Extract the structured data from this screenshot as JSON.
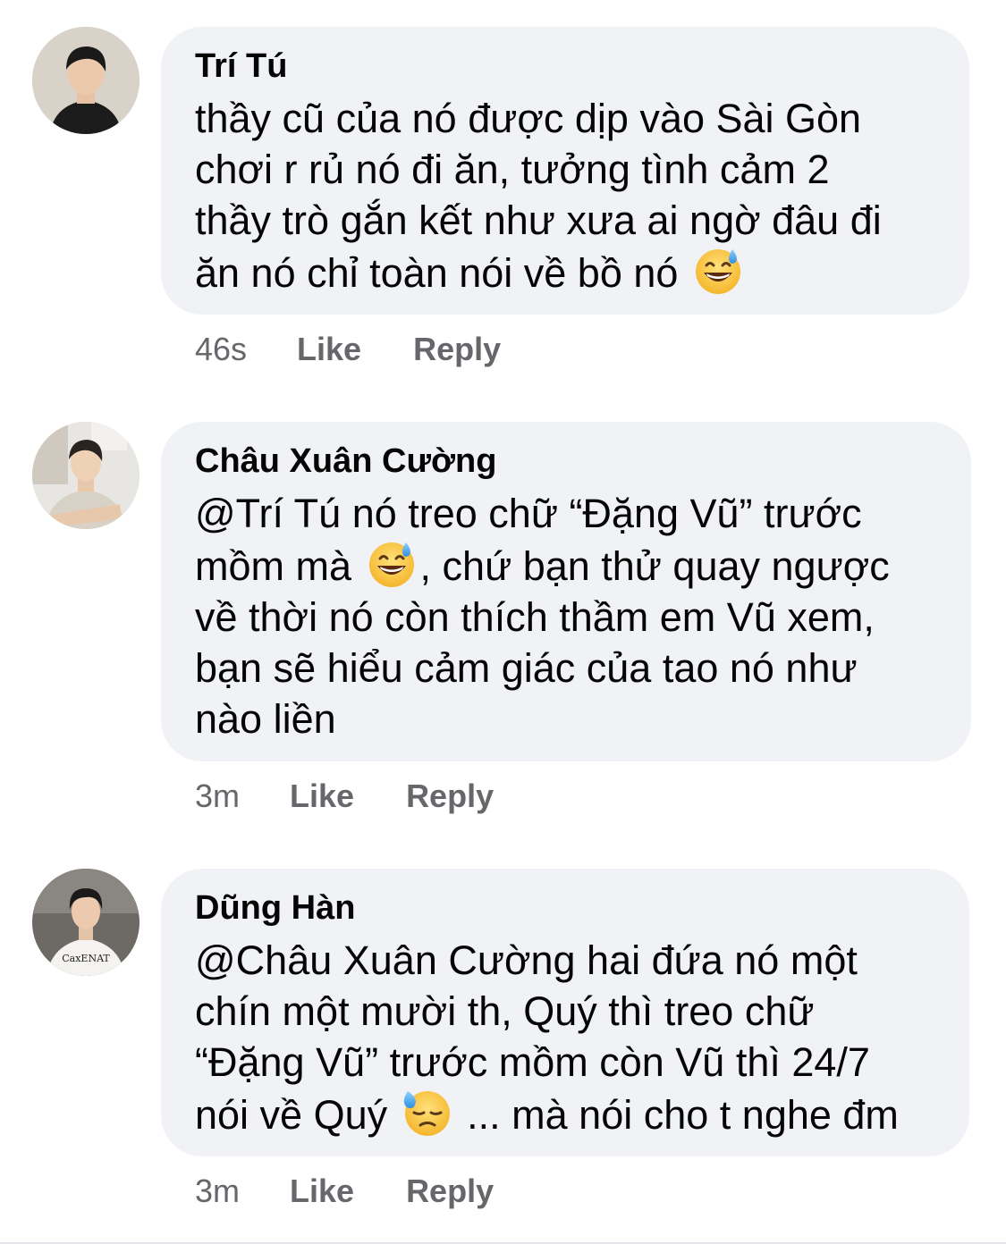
{
  "comments": [
    {
      "author": "Trí Tú",
      "lines": [
        "thầy cũ của nó được dịp vào Sài Gòn",
        "chơi r rủ nó đi ăn, tưởng tình cảm 2",
        "thầy trò gắn kết như xưa ai ngờ đâu đi",
        "ăn nó chỉ toàn nói về bồ nó"
      ],
      "emoji": "grinning-sweat-emoji",
      "time": "46s",
      "like_label": "Like",
      "reply_label": "Reply"
    },
    {
      "author": "Châu Xuân Cường",
      "line1": "@Trí Tú nó treo chữ “Đặng Vũ” trước",
      "line2_before": "mồm mà",
      "line2_after": ", chứ bạn thử quay ngược",
      "lines_rest": [
        "về thời nó còn thích thầm em Vũ xem,",
        "bạn sẽ hiểu cảm giác của tao nó như",
        "nào liền"
      ],
      "emoji": "grinning-sweat-emoji",
      "time": "3m",
      "like_label": "Like",
      "reply_label": "Reply"
    },
    {
      "author": "Dũng Hàn",
      "lines": [
        "@Châu Xuân Cường hai đứa nó một",
        "chín một mười th, Quý thì treo chữ",
        "“Đặng Vũ” trước mồm còn Vũ thì 24/7"
      ],
      "line4_before": "nói về Quý",
      "line4_after": "... mà nói cho t nghe đm",
      "emoji": "downcast-sweat-emoji",
      "time": "3m",
      "like_label": "Like",
      "reply_label": "Reply"
    }
  ]
}
